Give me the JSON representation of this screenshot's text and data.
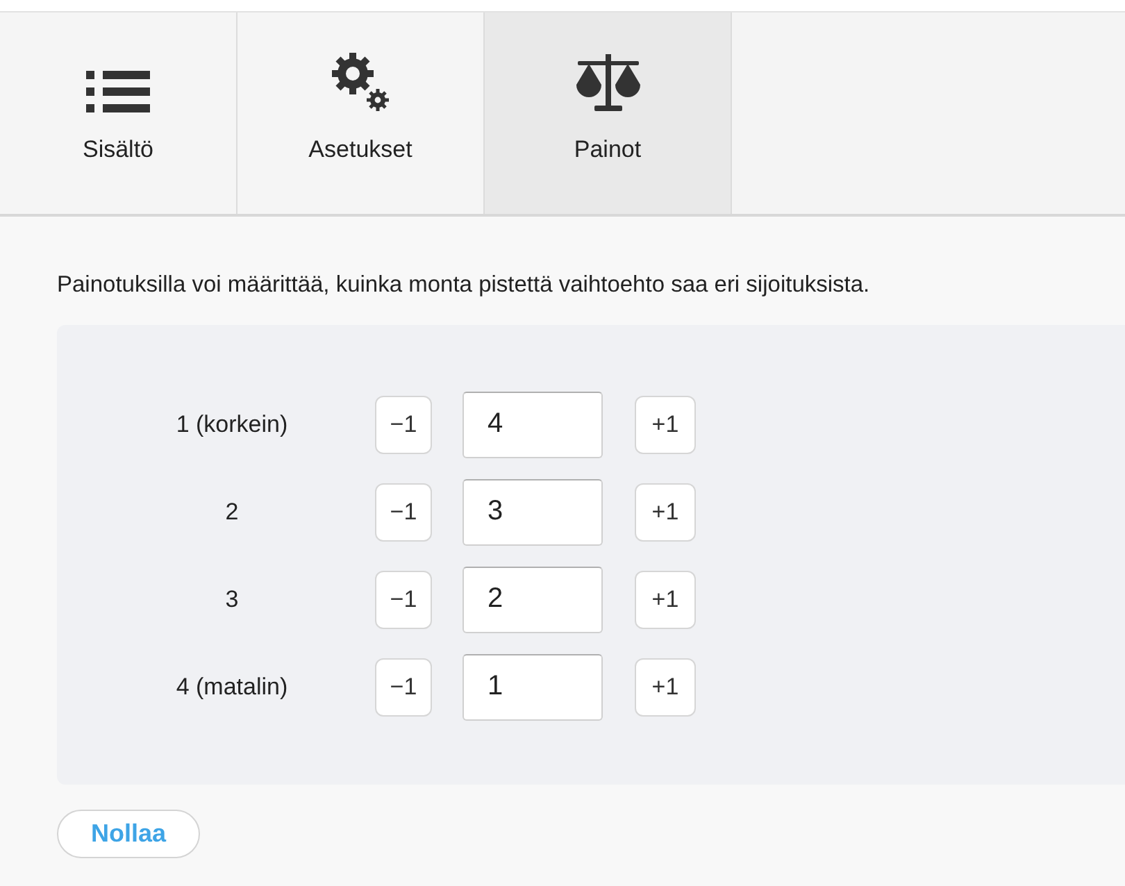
{
  "tabs": [
    {
      "label": "Sisältö",
      "kind": "list",
      "selected": false
    },
    {
      "label": "Asetukset",
      "kind": "gears",
      "selected": false
    },
    {
      "label": "Painot",
      "kind": "scale",
      "selected": true
    }
  ],
  "description": "Painotuksilla voi määrittää, kuinka monta pistettä vaihtoehto saa eri sijoituksista.",
  "weights": [
    {
      "label": "1 (korkein)",
      "decrement": "−1",
      "value": "4",
      "increment": "+1"
    },
    {
      "label": "2",
      "decrement": "−1",
      "value": "3",
      "increment": "+1"
    },
    {
      "label": "3",
      "decrement": "−1",
      "value": "2",
      "increment": "+1"
    },
    {
      "label": "4 (matalin)",
      "decrement": "−1",
      "value": "1",
      "increment": "+1"
    }
  ],
  "reset_button": "Nollaa"
}
